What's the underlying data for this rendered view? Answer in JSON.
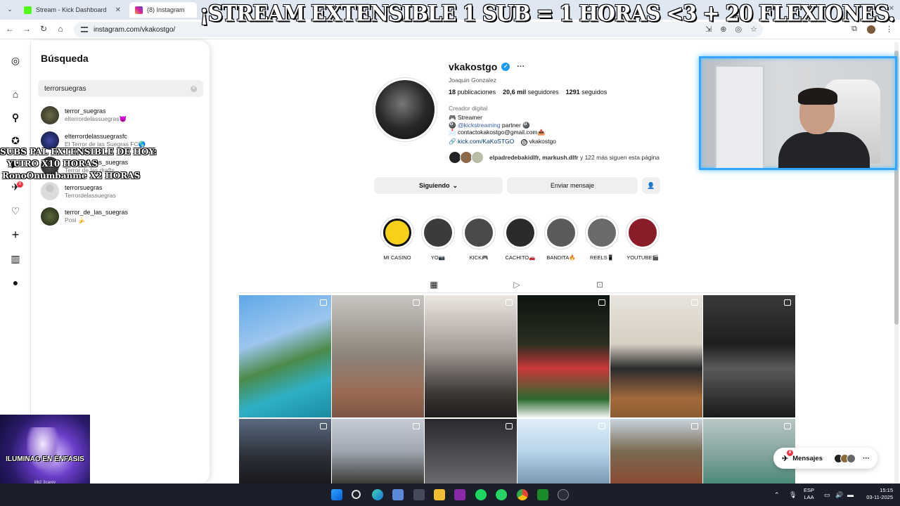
{
  "browser": {
    "tabs": [
      {
        "title": "Stream - Kick Dashboard",
        "favicon_color": "#53fc18"
      },
      {
        "title": "(8) Instagram",
        "favicon_color": "#d6249f"
      }
    ],
    "url": "instagram.com/vkakostgo/"
  },
  "overlay": {
    "banner": "¡STREAM EXTENSIBLE 1 SUB = 1 HORAS <3 + 20 FLEXIONES.",
    "lines": [
      "SUBS PAL EXTENSIBLE DE HOY:",
      "YUIRO X10 HORAS",
      "RonoOnumbanme X2 HORAS"
    ],
    "image_caption": "ILUMINAO EN ÉNFASIS",
    "image_small": "lilb2 3carey"
  },
  "search": {
    "title": "Búsqueda",
    "value": "terrorsuegras",
    "results": [
      {
        "username": "terror_suegras",
        "subtitle": "elterrordelassuegras😈"
      },
      {
        "username": "elterrordelassuegrasfc",
        "subtitle": "El Terror de las Suegras FC🌎"
      },
      {
        "username": "terror_de_las_suegras",
        "subtitle": "Terror de las drafts"
      },
      {
        "username": "terrorsuegras",
        "subtitle": "Terrordelassuegras"
      },
      {
        "username": "terror_de_las_suegras",
        "subtitle": "Posi 🍌"
      }
    ]
  },
  "nav": {
    "notif_badge": "8"
  },
  "profile": {
    "username": "vkakostgo",
    "full_name": "Joaquin Gonzalez",
    "stats": [
      {
        "num": "18",
        "label": "publicaciones"
      },
      {
        "num": "20,6 mil",
        "label": "seguidores"
      },
      {
        "num": "1291",
        "label": "seguidos"
      }
    ],
    "category": "Creador digital",
    "bio": [
      "🎮 Streamer",
      "@kickstreaming",
      "partner 🎱",
      "📩 contactokakostgo@gmail.com📤"
    ],
    "link": "kick.com/KaKoSTGO",
    "threads": "vkakostgo",
    "followed_by_names": "elpadredebakidlfr, markush.dlfr",
    "followed_by_rest": " y 122 más siguen esta página",
    "btn_following": "Siguiendo",
    "btn_message": "Enviar mensaje"
  },
  "highlights": [
    {
      "label": "MI CASINO",
      "color": "#f5d11a"
    },
    {
      "label": "YO📷",
      "color": "#3b3b3b"
    },
    {
      "label": "KICK🎮",
      "color": "#4a4a4a"
    },
    {
      "label": "CACHITO🚗",
      "color": "#2b2b2b"
    },
    {
      "label": "BANDITA🔥",
      "color": "#5a5a5a"
    },
    {
      "label": "REELS📱",
      "color": "#6a6a6a"
    },
    {
      "label": "YOUTUBE🎬",
      "color": "#8a1c2a"
    }
  ],
  "messages": {
    "label": "Mensajes",
    "badge": "8"
  },
  "taskbar": {
    "lang": "ESP",
    "lang2": "LAA",
    "time": "15:15",
    "date": "03-11-2025"
  }
}
